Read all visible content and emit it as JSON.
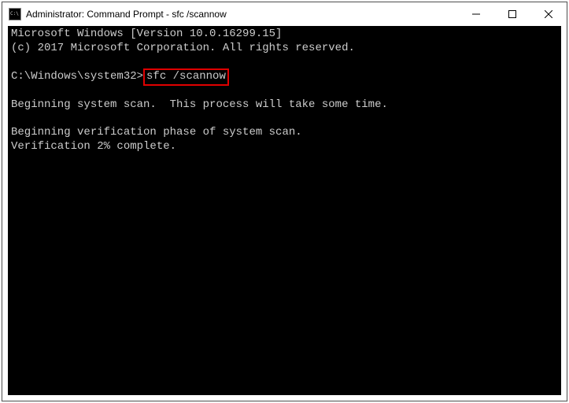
{
  "titlebar": {
    "title": "Administrator: Command Prompt - sfc  /scannow"
  },
  "terminal": {
    "version_line": "Microsoft Windows [Version 10.0.16299.15]",
    "copyright_line": "(c) 2017 Microsoft Corporation. All rights reserved.",
    "prompt_prefix": "C:\\Windows\\system32>",
    "command": "sfc /scannow",
    "scan_beginning": "Beginning system scan.  This process will take some time.",
    "verification_phase": "Beginning verification phase of system scan.",
    "verification_progress": "Verification 2% complete."
  }
}
